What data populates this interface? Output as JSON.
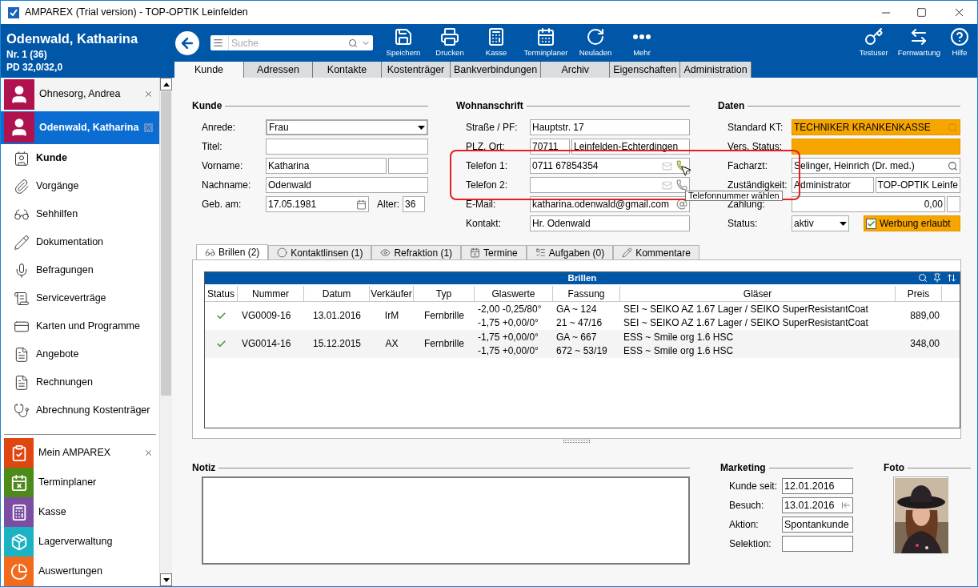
{
  "window": {
    "title": "AMPAREX (Trial version) - TOP-OPTIK Leinfelden"
  },
  "header": {
    "name": "Odenwald, Katharina",
    "number": "Nr. 1 (36)",
    "pd": "PD 32,0/32,0"
  },
  "toolbar": {
    "search_placeholder": "Suche",
    "buttons": [
      {
        "label": "Speichern"
      },
      {
        "label": "Drucken"
      },
      {
        "label": "Kasse"
      },
      {
        "label": "Terminplaner"
      },
      {
        "label": "Neuladen"
      },
      {
        "label": "Mehr"
      }
    ],
    "right_buttons": [
      {
        "label": "Testuser"
      },
      {
        "label": "Fernwartung"
      },
      {
        "label": "Hilfe"
      }
    ]
  },
  "tabs": [
    {
      "label": "Kunde",
      "selected": true
    },
    {
      "label": "Adressen",
      "selected": false
    },
    {
      "label": "Kontakte",
      "selected": false
    },
    {
      "label": "Kostenträger",
      "selected": false
    },
    {
      "label": "Bankverbindungen",
      "selected": false
    },
    {
      "label": "Archiv",
      "selected": false
    },
    {
      "label": "Eigenschaften",
      "selected": false
    },
    {
      "label": "Administration",
      "selected": false
    }
  ],
  "sidebar": {
    "customers": [
      {
        "name": "Ohnesorg, Andrea",
        "selected": false
      },
      {
        "name": "Odenwald, Katharina",
        "selected": true
      }
    ],
    "menu": [
      {
        "label": "Kunde",
        "selected": true
      },
      {
        "label": "Vorgänge",
        "selected": false
      },
      {
        "label": "Sehhilfen",
        "selected": false
      },
      {
        "label": "Dokumentation",
        "selected": false
      },
      {
        "label": "Befragungen",
        "selected": false
      },
      {
        "label": "Serviceverträge",
        "selected": false
      },
      {
        "label": "Karten und Programme",
        "selected": false
      },
      {
        "label": "Angebote",
        "selected": false
      },
      {
        "label": "Rechnungen",
        "selected": false
      },
      {
        "label": "Abrechnung Kostenträger",
        "selected": false
      }
    ],
    "apps": [
      {
        "label": "Mein AMPAREX",
        "color": "#e0460f",
        "closable": true
      },
      {
        "label": "Terminplaner",
        "color": "#4e8a1a",
        "closable": false
      },
      {
        "label": "Kasse",
        "color": "#7b4ea3",
        "closable": false
      },
      {
        "label": "Lagerverwaltung",
        "color": "#1bb3c4",
        "closable": false
      },
      {
        "label": "Auswertungen",
        "color": "#f26b1d",
        "closable": false
      }
    ]
  },
  "kunde": {
    "title": "Kunde",
    "rows": [
      {
        "label": "Anrede:",
        "inputs": [
          {
            "kind": "select",
            "value": "Frau",
            "focused": true
          }
        ]
      },
      {
        "label": "Titel:",
        "inputs": [
          {
            "kind": "text"
          }
        ]
      },
      {
        "label": "Vorname:",
        "inputs": [
          {
            "kind": "text",
            "value": "Katharina"
          },
          {
            "kind": "short"
          }
        ]
      },
      {
        "label": "Nachname:",
        "inputs": [
          {
            "kind": "text",
            "value": "Odenwald"
          }
        ]
      },
      {
        "label": "Geb. am:",
        "inputs": [
          {
            "kind": "date",
            "value": "17.05.1981"
          },
          {
            "kind": "label",
            "value": "Alter:"
          },
          {
            "kind": "age",
            "value": "36"
          }
        ]
      }
    ]
  },
  "wohnanschrift": {
    "title": "Wohnanschrift",
    "rows": [
      {
        "label": "Straße / PF:",
        "inputs": [
          {
            "kind": "text",
            "value": "Hauptstr. 17"
          }
        ]
      },
      {
        "label": "PLZ, Ort:",
        "inputs": [
          {
            "kind": "short",
            "value": "70711"
          },
          {
            "kind": "text",
            "value": "Leinfelden-Echterdingen"
          }
        ]
      },
      {
        "label": "Telefon 1:",
        "inputs": [
          {
            "kind": "phone",
            "value": "0711 67854354",
            "active": true
          }
        ]
      },
      {
        "label": "Telefon 2:",
        "inputs": [
          {
            "kind": "phone",
            "active": false
          }
        ]
      },
      {
        "label": "E-Mail:",
        "inputs": [
          {
            "kind": "email",
            "value": "katharina.odenwald@gmail.com"
          }
        ]
      },
      {
        "label": "Kontakt:",
        "inputs": [
          {
            "kind": "text",
            "value": "Hr. Odenwald"
          }
        ]
      }
    ]
  },
  "daten": {
    "title": "Daten",
    "rows": [
      {
        "label": "Standard KT:",
        "inputs": [
          {
            "kind": "search",
            "value": "TECHNIKER KRANKENKASSE",
            "highlight": true
          }
        ]
      },
      {
        "label": "Vers. Status:",
        "inputs": [
          {
            "kind": "text",
            "highlight": true
          }
        ]
      },
      {
        "label": "Facharzt:",
        "inputs": [
          {
            "kind": "search",
            "value": "Selinger, Heinrich (Dr. med.)"
          }
        ]
      },
      {
        "label": "Zuständigkeit:",
        "inputs": [
          {
            "kind": "text",
            "value": "Administrator"
          },
          {
            "kind": "text",
            "value": "TOP-OPTIK Leinfe"
          }
        ]
      },
      {
        "label": "Zahlung:",
        "inputs": [
          {
            "kind": "amount",
            "value": "0,00"
          },
          {
            "kind": "stub"
          }
        ]
      },
      {
        "label": "Status:",
        "inputs": [
          {
            "kind": "dropdown",
            "value": "aktiv"
          },
          {
            "kind": "checkbox",
            "value": "Werbung erlaubt",
            "checked": true,
            "highlight": true
          }
        ]
      }
    ]
  },
  "tooltip": {
    "text": "Telefonnummer wählen"
  },
  "subtabs": [
    {
      "label": "Brillen (2)",
      "selected": true
    },
    {
      "label": "Kontaktlinsen (1)",
      "selected": false
    },
    {
      "label": "Refraktion (1)",
      "selected": false
    },
    {
      "label": "Termine",
      "selected": false
    },
    {
      "label": "Aufgaben (0)",
      "selected": false
    },
    {
      "label": "Kommentare",
      "selected": false
    }
  ],
  "table": {
    "title": "Brillen",
    "columns": [
      "Status",
      "Nummer",
      "Datum",
      "Verkäufer",
      "Typ",
      "Glaswerte",
      "Fassung",
      "Gläser",
      "Preis"
    ],
    "rows": [
      {
        "cells": [
          {
            "ok": true
          },
          "VG0009-16",
          "13.01.2016",
          "IrM",
          "Fernbrille",
          [
            "-2,00 -0,25/80°",
            "-1,75 +0,00/0°"
          ],
          [
            "GA ~ 124",
            "21 ~ 47/16"
          ],
          [
            "SEI ~ SEIKO AZ 1.67 Lager / SEIKO SuperResistantCoat",
            "SEI ~ SEIKO AZ 1.67 Lager / SEIKO SuperResistantCoat"
          ],
          "889,00"
        ]
      },
      {
        "cells": [
          {
            "ok": true
          },
          "VG0014-16",
          "15.12.2015",
          "AX",
          "Fernbrille",
          [
            "-1,75 +0,00/0°",
            "-1,75 +0,00/0°"
          ],
          [
            "GA ~ 667",
            "672 ~ 53/19"
          ],
          [
            "ESS ~ Smile org 1.6 HSC",
            "ESS ~ Smile org 1.6 HSC"
          ],
          "348,00"
        ]
      }
    ]
  },
  "notiz": {
    "title": "Notiz"
  },
  "marketing": {
    "title": "Marketing",
    "rows": [
      {
        "label": "Kunde seit:",
        "value": "12.01.2016"
      },
      {
        "label": "Besuch:",
        "value": "13.01.2016",
        "kind": "visit"
      },
      {
        "label": "Aktion:",
        "value": "Spontankunde"
      },
      {
        "label": "Selektion:"
      }
    ]
  },
  "foto": {
    "title": "Foto"
  }
}
